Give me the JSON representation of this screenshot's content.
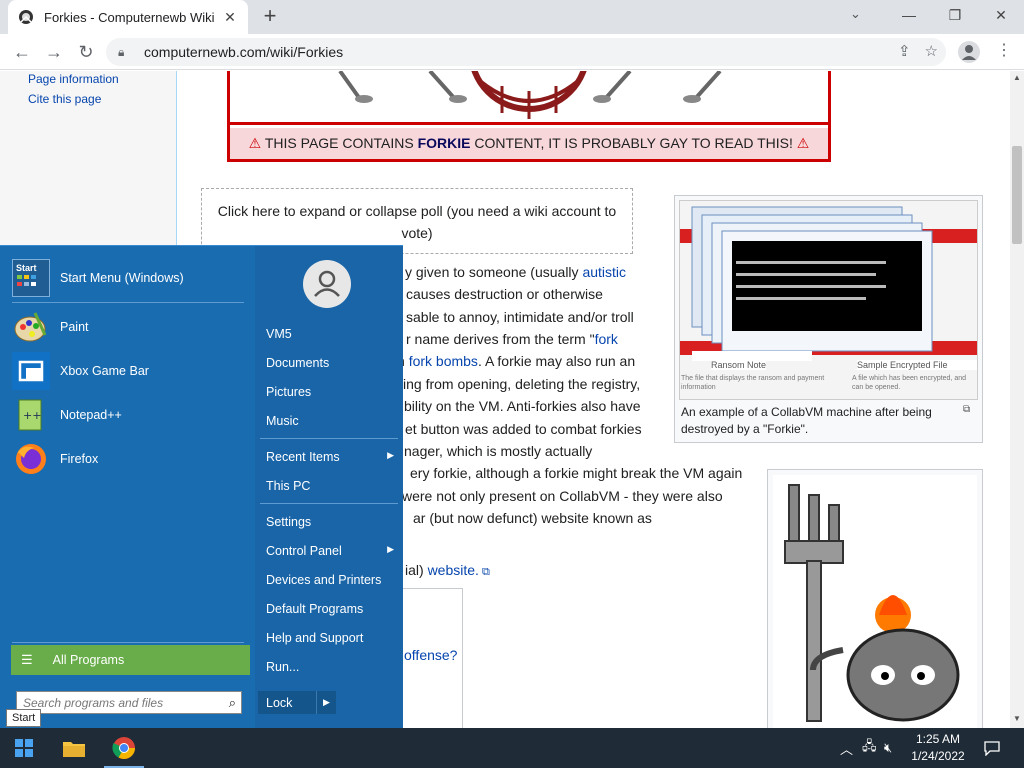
{
  "browser": {
    "tab_title": "Forkies - Computernewb Wiki",
    "url": "computernewb.com/wiki/Forkies",
    "new_tab_symbol": "+",
    "close_symbol": "✕"
  },
  "sidebar": {
    "links": [
      "Page information",
      "Cite this page"
    ]
  },
  "warning": {
    "prefix": "THIS PAGE CONTAINS ",
    "keyword": "FORKIE",
    "suffix": " CONTENT, IT IS PROBABLY GAY TO READ THIS!"
  },
  "poll": {
    "text": "Click here to expand or collapse poll (you need a wiki account to vote)"
  },
  "body_lines": [
    {
      "pre": "y given to someone (usually ",
      "link": "autistic",
      "post": ""
    },
    {
      "pre": " causes destruction or otherwise",
      "link": "",
      "post": ""
    },
    {
      "pre": "sable to annoy, intimidate and/or troll",
      "link": "",
      "post": ""
    },
    {
      "pre": "r name derives from the term \"",
      "link": "fork",
      "post": ""
    },
    {
      "pre": "n ",
      "link": "fork bombs",
      "post": ". A forkie may also run an"
    },
    {
      "pre": "ing from opening, deleting the registry,",
      "link": "",
      "post": ""
    },
    {
      "pre": "bility on the VM. Anti-forkies also have",
      "link": "",
      "post": ""
    },
    {
      "pre": "et button was added to combat forkies",
      "link": "",
      "post": ""
    },
    {
      "pre": "nager, which is mostly actually",
      "link": "",
      "post": ""
    },
    {
      "pre": "ery forkie, although a forkie might break the VM again",
      "link": "",
      "post": ""
    },
    {
      "pre": "were not only present on CollabVM - they were also",
      "link": "",
      "post": ""
    },
    {
      "pre": "ar (but now defunct) website known as",
      "link": "",
      "post": ""
    }
  ],
  "body_extra": {
    "website_pre": "ial) ",
    "website_link": "website.",
    "offense": "offense?"
  },
  "thumb1": {
    "caption": "An example of a CollabVM machine after being destroyed by a \"Forkie\".",
    "inner_labels": [
      "Ransom Note",
      "Sample Encrypted File",
      "The file that displays the ransom and payment information",
      "A file which has been encrypted, and can be opened."
    ]
  },
  "start_menu": {
    "pinned": [
      {
        "label": "Start Menu (Windows)",
        "icon": "start-menu-app-icon"
      },
      {
        "label": "Paint",
        "icon": "paint-icon"
      },
      {
        "label": "Xbox Game Bar",
        "icon": "xbox-game-bar-icon"
      },
      {
        "label": "Notepad++",
        "icon": "notepad-plus-plus-icon"
      },
      {
        "label": "Firefox",
        "icon": "firefox-icon"
      }
    ],
    "start_app_icon_text": "Start",
    "all_programs": "All Programs",
    "search_placeholder": "Search programs and files",
    "right_items": [
      {
        "label": "VM5",
        "arrow": false
      },
      {
        "label": "Documents",
        "arrow": false
      },
      {
        "label": "Pictures",
        "arrow": false
      },
      {
        "label": "Music",
        "arrow": false
      },
      {
        "label": "Recent Items",
        "arrow": true
      },
      {
        "label": "This PC",
        "arrow": false
      },
      {
        "label": "Settings",
        "arrow": false
      },
      {
        "label": "Control Panel",
        "arrow": true
      },
      {
        "label": "Devices and Printers",
        "arrow": false
      },
      {
        "label": "Default Programs",
        "arrow": false
      },
      {
        "label": "Help and Support",
        "arrow": false
      },
      {
        "label": "Run...",
        "arrow": false
      }
    ],
    "lock": "Lock",
    "tooltip": "Start"
  },
  "taskbar": {
    "time": "1:25 AM",
    "date": "1/24/2022"
  },
  "colors": {
    "start_menu_bg": "#1a6cb0",
    "all_programs_green": "#68ad4a",
    "taskbar": "#1f2b36",
    "warning_red": "#cc0000"
  }
}
